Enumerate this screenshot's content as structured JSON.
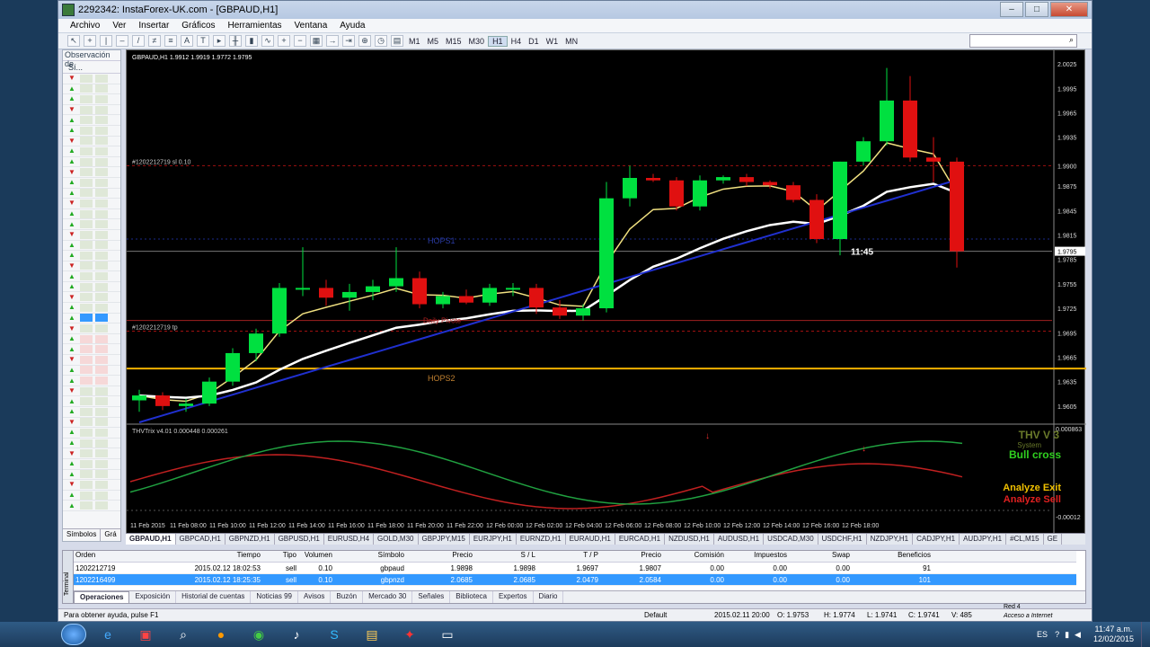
{
  "window": {
    "title": "2292342: InstaForex-UK.com - [GBPAUD,H1]",
    "minimize": "–",
    "maximize": "□",
    "close": "✕"
  },
  "menu": [
    "Archivo",
    "Ver",
    "Insertar",
    "Gráficos",
    "Herramientas",
    "Ventana",
    "Ayuda"
  ],
  "toolbar": {
    "timeframes": [
      "M1",
      "M5",
      "M15",
      "M30",
      "H1",
      "H4",
      "D1",
      "W1",
      "MN"
    ],
    "active_timeframe": "H1",
    "search_icon": "search-icon"
  },
  "market_watch": {
    "title": "Observación de",
    "header": "Sí...",
    "tabs": [
      "Símbolos",
      "Grá"
    ]
  },
  "chart": {
    "header": "GBPAUD,H1  1.9912 1.9919 1.9772 1.9795",
    "sl_label": "#1202212719 sl 0.10",
    "tp_label": "#1202212719 tp",
    "hops1": "HOPS1",
    "hops2": "HOPS2",
    "pivot": "Daily Pivote",
    "timer": "11:45",
    "price_current": "1.9795",
    "price_ticks": [
      "2.0025",
      "1.9995",
      "1.9965",
      "1.9935",
      "1.9900",
      "1.9875",
      "1.9845",
      "1.9815",
      "1.9785",
      "1.9755",
      "1.9725",
      "1.9695",
      "1.9665",
      "1.9635",
      "1.9605"
    ],
    "time_ticks": [
      "11 Feb 2015",
      "11 Feb 08:00",
      "11 Feb 10:00",
      "11 Feb 12:00",
      "11 Feb 14:00",
      "11 Feb 16:00",
      "11 Feb 18:00",
      "11 Feb 20:00",
      "11 Feb 22:00",
      "12 Feb 00:00",
      "12 Feb 02:00",
      "12 Feb 04:00",
      "12 Feb 06:00",
      "12 Feb 08:00",
      "12 Feb 10:00",
      "12 Feb 12:00",
      "12 Feb 14:00",
      "12 Feb 16:00",
      "12 Feb 18:00"
    ],
    "indicator_label": "THVTrix v4.01 0.000448 0.000261",
    "indicator_max": "0.000863",
    "indicator_min": "-0.00012",
    "thv_title": "THV V 3",
    "thv_sub": "System",
    "thv_signal": "Bull cross",
    "analyze_exit": "Analyze Exit",
    "analyze_sell": "Analyze Sell",
    "chart_data": {
      "type": "candlestick",
      "symbol": "GBPAUD",
      "timeframe": "H1",
      "ylim": [
        1.9585,
        2.0035
      ],
      "candles": [
        {
          "o": 1.9612,
          "h": 1.9625,
          "l": 1.9598,
          "c": 1.9618
        },
        {
          "o": 1.9618,
          "h": 1.9622,
          "l": 1.96,
          "c": 1.9605
        },
        {
          "o": 1.9605,
          "h": 1.9614,
          "l": 1.9598,
          "c": 1.9608
        },
        {
          "o": 1.9608,
          "h": 1.964,
          "l": 1.9605,
          "c": 1.9635
        },
        {
          "o": 1.9635,
          "h": 1.9676,
          "l": 1.963,
          "c": 1.967
        },
        {
          "o": 1.967,
          "h": 1.97,
          "l": 1.966,
          "c": 1.9694
        },
        {
          "o": 1.9694,
          "h": 1.9756,
          "l": 1.969,
          "c": 1.975
        },
        {
          "o": 1.975,
          "h": 1.98,
          "l": 1.974,
          "c": 1.975
        },
        {
          "o": 1.975,
          "h": 1.976,
          "l": 1.9728,
          "c": 1.9738
        },
        {
          "o": 1.9738,
          "h": 1.9755,
          "l": 1.9722,
          "c": 1.9745
        },
        {
          "o": 1.9745,
          "h": 1.976,
          "l": 1.9735,
          "c": 1.9752
        },
        {
          "o": 1.9752,
          "h": 1.98,
          "l": 1.9745,
          "c": 1.9762
        },
        {
          "o": 1.9762,
          "h": 1.977,
          "l": 1.9725,
          "c": 1.973
        },
        {
          "o": 1.973,
          "h": 1.9745,
          "l": 1.9725,
          "c": 1.974
        },
        {
          "o": 1.974,
          "h": 1.9748,
          "l": 1.973,
          "c": 1.9732
        },
        {
          "o": 1.9732,
          "h": 1.9755,
          "l": 1.9728,
          "c": 1.975
        },
        {
          "o": 1.975,
          "h": 1.9756,
          "l": 1.974,
          "c": 1.975
        },
        {
          "o": 1.975,
          "h": 1.9755,
          "l": 1.9718,
          "c": 1.9726
        },
        {
          "o": 1.9726,
          "h": 1.9735,
          "l": 1.9712,
          "c": 1.9716
        },
        {
          "o": 1.9716,
          "h": 1.973,
          "l": 1.971,
          "c": 1.9725
        },
        {
          "o": 1.9725,
          "h": 1.988,
          "l": 1.972,
          "c": 1.986
        },
        {
          "o": 1.986,
          "h": 1.99,
          "l": 1.985,
          "c": 1.9885
        },
        {
          "o": 1.9885,
          "h": 1.989,
          "l": 1.988,
          "c": 1.9882
        },
        {
          "o": 1.9882,
          "h": 1.9886,
          "l": 1.9845,
          "c": 1.985
        },
        {
          "o": 1.985,
          "h": 1.9888,
          "l": 1.9845,
          "c": 1.9882
        },
        {
          "o": 1.9882,
          "h": 1.9888,
          "l": 1.9878,
          "c": 1.9886
        },
        {
          "o": 1.9886,
          "h": 1.989,
          "l": 1.9875,
          "c": 1.988
        },
        {
          "o": 1.988,
          "h": 1.9882,
          "l": 1.9872,
          "c": 1.9876
        },
        {
          "o": 1.9876,
          "h": 1.988,
          "l": 1.9855,
          "c": 1.9858
        },
        {
          "o": 1.9858,
          "h": 1.9865,
          "l": 1.9805,
          "c": 1.981
        },
        {
          "o": 1.981,
          "h": 1.9905,
          "l": 1.979,
          "c": 1.9905
        },
        {
          "o": 1.9905,
          "h": 1.9935,
          "l": 1.99,
          "c": 1.993
        },
        {
          "o": 1.993,
          "h": 2.002,
          "l": 1.9925,
          "c": 1.998
        },
        {
          "o": 1.998,
          "h": 2.001,
          "l": 1.9905,
          "c": 1.991
        },
        {
          "o": 1.991,
          "h": 1.9935,
          "l": 1.988,
          "c": 1.9905
        },
        {
          "o": 1.9905,
          "h": 1.991,
          "l": 1.9775,
          "c": 1.9795
        }
      ]
    }
  },
  "chart_tabs": [
    "GBPAUD,H1",
    "GBPCAD,H1",
    "GBPNZD,H1",
    "GBPUSD,H1",
    "EURUSD,H4",
    "GOLD,M30",
    "GBPJPY,M15",
    "EURJPY,H1",
    "EURNZD,H1",
    "EURAUD,H1",
    "EURCAD,H1",
    "NZDUSD,H1",
    "AUDUSD,H1",
    "USDCAD,M30",
    "USDCHF,H1",
    "NZDJPY,H1",
    "CADJPY,H1",
    "AUDJPY,H1",
    "#CL,M15",
    "GE"
  ],
  "terminal": {
    "side_label": "Terminal",
    "headers": [
      "Orden",
      "Tiempo",
      "Tipo",
      "Volumen",
      "Símbolo",
      "Precio",
      "S / L",
      "T / P",
      "Precio",
      "Comisión",
      "Impuestos",
      "Swap",
      "Beneficios"
    ],
    "rows": [
      [
        "1202212719",
        "2015.02.12 18:02:53",
        "sell",
        "0.10",
        "gbpaud",
        "1.9898",
        "1.9898",
        "1.9697",
        "1.9807",
        "0.00",
        "0.00",
        "0.00",
        "91"
      ],
      [
        "1202216499",
        "2015.02.12 18:25:35",
        "sell",
        "0.10",
        "gbpnzd",
        "2.0685",
        "2.0685",
        "2.0479",
        "2.0584",
        "0.00",
        "0.00",
        "0.00",
        "101"
      ]
    ],
    "tabs": [
      "Operaciones",
      "Exposición",
      "Historial de cuentas",
      "Noticias 99",
      "Avisos",
      "Buzón",
      "Mercado 30",
      "Señales",
      "Biblioteca",
      "Expertos",
      "Diario"
    ]
  },
  "status": {
    "help": "Para obtener ayuda, pulse F1",
    "profile": "Default",
    "datetime": "2015.02.11 20:00",
    "o": "O: 1.9753",
    "h": "H: 1.9774",
    "l": "L: 1.9741",
    "c": "C: 1.9741",
    "v": "V: 485",
    "net_title": "Red 4",
    "net_sub": "Acceso a Internet"
  },
  "taskbar": {
    "lang": "ES",
    "time": "11:47 a.m.",
    "date": "12/02/2015"
  },
  "colors": {
    "bull": "#00e040",
    "bear": "#e01010",
    "ema_fast": "#f0e080",
    "ema_slow": "#ffffff",
    "ma_blue": "#2030d0",
    "hops2_line": "#f0b000"
  }
}
